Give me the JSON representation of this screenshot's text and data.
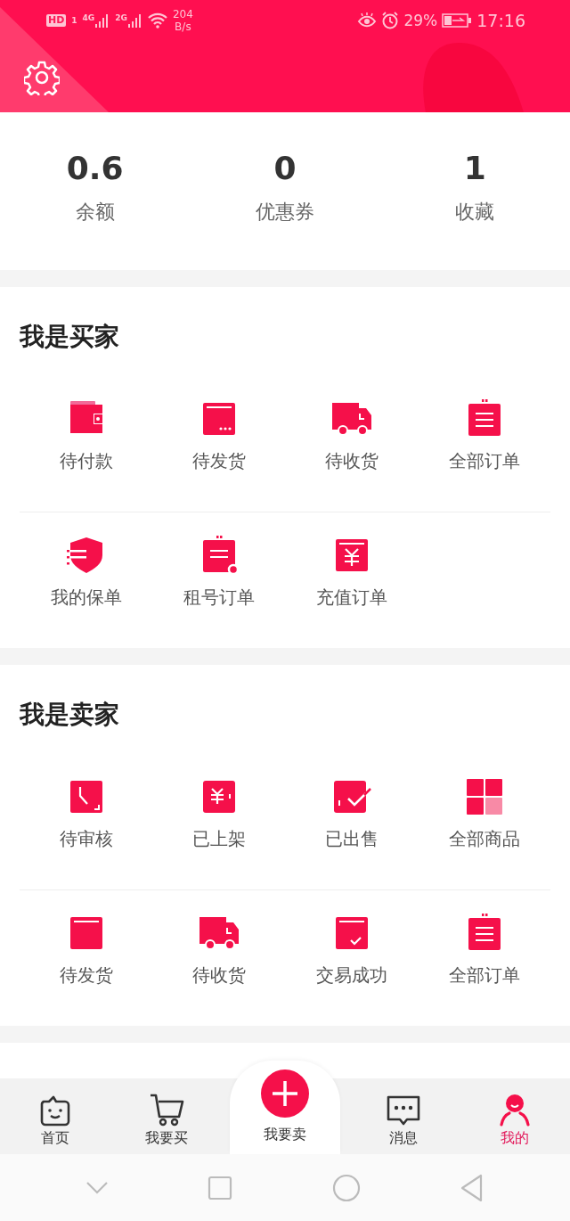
{
  "status_bar": {
    "network_badge": "HD",
    "sim_slot": "1",
    "sim1_type": "4G",
    "sim2_type": "2G",
    "speed_value": "204",
    "speed_unit": "B/s",
    "battery": "29%",
    "time": "17:16"
  },
  "stats": [
    {
      "value": "0.6",
      "label": "余额"
    },
    {
      "value": "0",
      "label": "优惠券"
    },
    {
      "value": "1",
      "label": "收藏"
    }
  ],
  "sections": [
    {
      "title": "我是买家",
      "rows": [
        [
          {
            "label": "待付款",
            "kind": "wallet"
          },
          {
            "label": "待发货",
            "kind": "boxdots"
          },
          {
            "label": "待收货",
            "kind": "truck"
          },
          {
            "label": "全部订单",
            "kind": "clipboard"
          }
        ],
        [
          {
            "label": "我的保单",
            "kind": "shield"
          },
          {
            "label": "租号订单",
            "kind": "clipbadge"
          },
          {
            "label": "充值订单",
            "kind": "yuanbox"
          }
        ]
      ]
    },
    {
      "title": "我是卖家",
      "rows": [
        [
          {
            "label": "待审核",
            "kind": "clockbox"
          },
          {
            "label": "已上架",
            "kind": "yuantag"
          },
          {
            "label": "已出售",
            "kind": "checkbox"
          },
          {
            "label": "全部商品",
            "kind": "grid"
          }
        ],
        [
          {
            "label": "待发货",
            "kind": "box"
          },
          {
            "label": "待收货",
            "kind": "truck"
          },
          {
            "label": "交易成功",
            "kind": "boxcheck"
          },
          {
            "label": "全部订单",
            "kind": "clipboard"
          }
        ]
      ]
    }
  ],
  "tab_bar": [
    {
      "label": "首页",
      "kind": "home",
      "selected": false
    },
    {
      "label": "我要买",
      "kind": "cart",
      "selected": false
    },
    {
      "label": "我要卖",
      "kind": "plus",
      "selected": false
    },
    {
      "label": "消息",
      "kind": "chat",
      "selected": false
    },
    {
      "label": "我的",
      "kind": "person",
      "selected": true
    }
  ]
}
